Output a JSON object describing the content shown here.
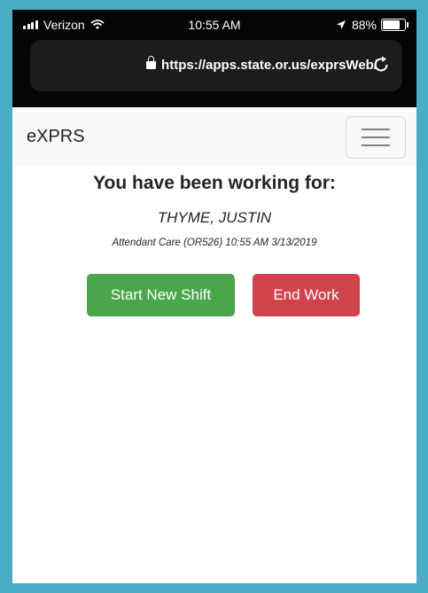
{
  "status_bar": {
    "carrier": "Verizon",
    "time": "10:55 AM",
    "battery_percent": "88%",
    "battery_level": 0.88
  },
  "browser": {
    "url": "https://apps.state.or.us/exprsWeb/"
  },
  "navbar": {
    "brand": "eXPRS"
  },
  "main": {
    "heading": "You have been working for:",
    "client_name": "THYME, JUSTIN",
    "details": "Attendant Care (OR526) 10:55 AM 3/13/2019",
    "start_button": "Start New Shift",
    "end_button": "End Work"
  },
  "colors": {
    "frame": "#4bacc6",
    "start_button": "#4aa64a",
    "end_button": "#d0434b"
  }
}
